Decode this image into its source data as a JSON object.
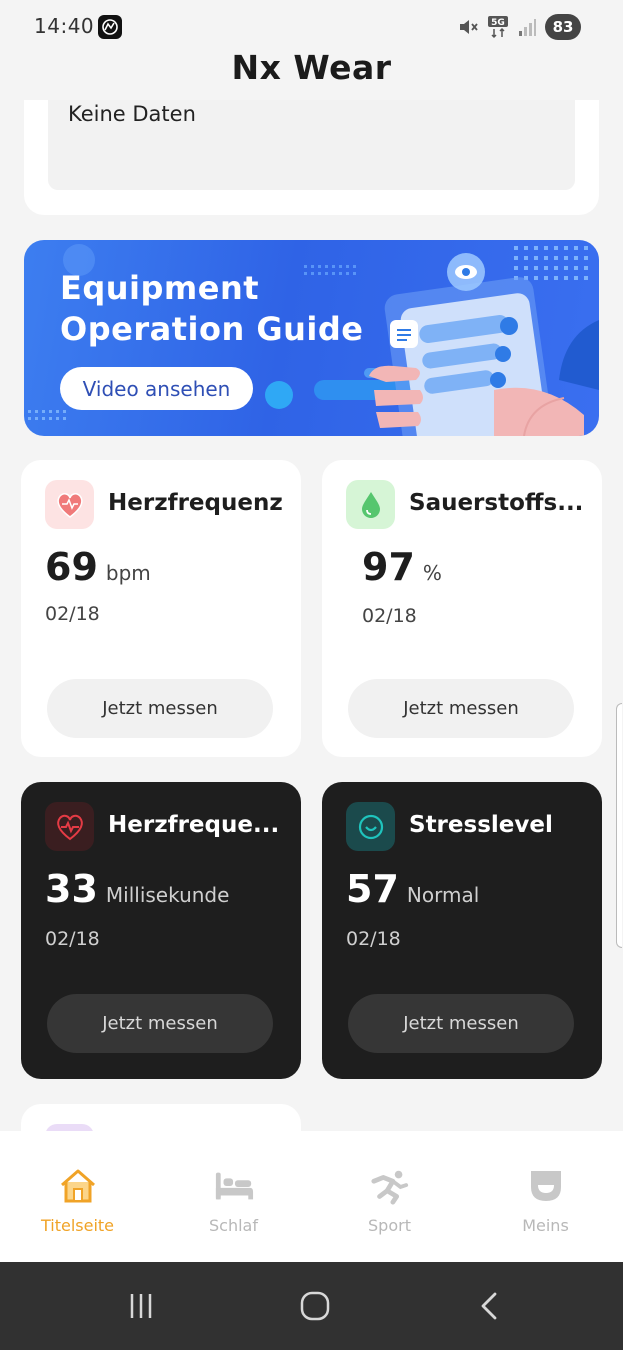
{
  "status_bar": {
    "time": "14:40",
    "battery": "83",
    "icons": [
      "app-notification-icon",
      "mute-icon",
      "5g-icon",
      "signal-icon",
      "battery-icon"
    ]
  },
  "app": {
    "title": "Nx Wear"
  },
  "previous_card": {
    "no_data_text": "Keine Daten"
  },
  "banner": {
    "title_line1": "Equipment",
    "title_line2": "Operation Guide",
    "button_label": "Video ansehen"
  },
  "cards": [
    {
      "id": "heart-rate",
      "title": "Herzfrequenz",
      "value": "69",
      "unit": "bpm",
      "date": "02/18",
      "button": "Jetzt messen",
      "theme": "light",
      "icon": "heart-icon",
      "accent": "#f06a6a"
    },
    {
      "id": "oxygen",
      "title": "Sauerstoffs...",
      "value": "97",
      "unit": "%",
      "date": "02/18",
      "button": "Jetzt messen",
      "theme": "light",
      "icon": "droplet-icon",
      "accent": "#4fc46a"
    },
    {
      "id": "hrv",
      "title": "Herzfreque...",
      "value": "33",
      "unit": "Millisekunde",
      "date": "02/18",
      "button": "Jetzt messen",
      "theme": "dark",
      "icon": "heart-pulse-icon",
      "accent": "#e0353f"
    },
    {
      "id": "stress",
      "title": "Stresslevel",
      "value": "57",
      "unit": "Normal",
      "date": "02/18",
      "button": "Jetzt messen",
      "theme": "dark",
      "icon": "smile-face-icon",
      "accent": "#1fb6b0"
    }
  ],
  "bottom_nav": {
    "items": [
      {
        "label": "Titelseite",
        "icon": "home-icon",
        "active": true
      },
      {
        "label": "Schlaf",
        "icon": "bed-icon",
        "active": false
      },
      {
        "label": "Sport",
        "icon": "running-icon",
        "active": false
      },
      {
        "label": "Meins",
        "icon": "profile-icon",
        "active": false
      }
    ],
    "active_color": "#f0a327",
    "inactive_color": "#b8b8b8"
  },
  "system_nav": {
    "buttons": [
      "recents-icon",
      "home-circle-icon",
      "back-icon"
    ]
  }
}
